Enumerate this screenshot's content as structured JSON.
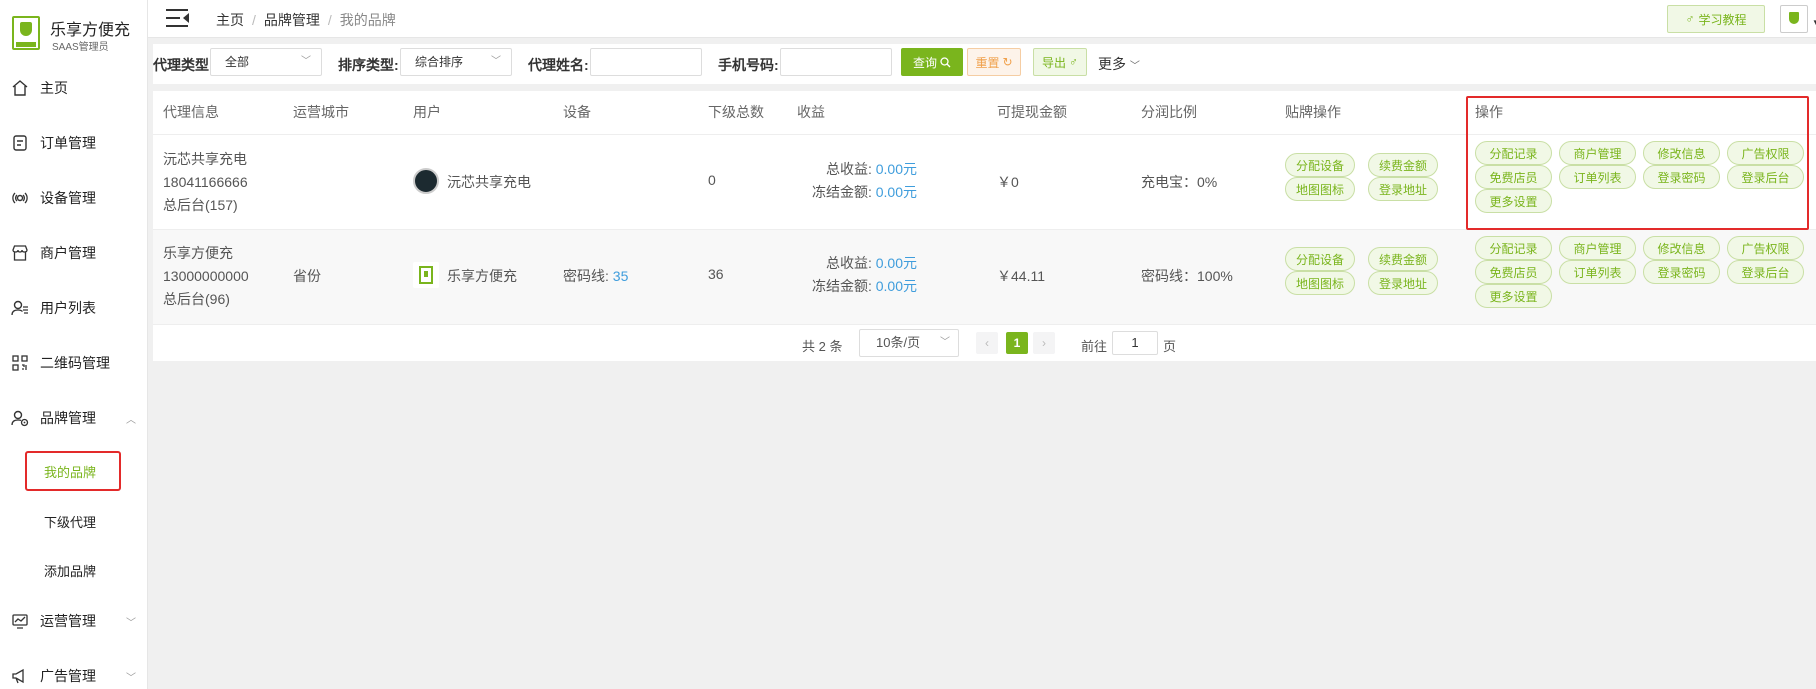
{
  "app": {
    "title": "乐享方便充",
    "subtitle": "SAAS管理员",
    "accent": "#7ab51d"
  },
  "sidebar": {
    "items": [
      {
        "label": "主页",
        "icon": "home-icon"
      },
      {
        "label": "订单管理",
        "icon": "order-icon"
      },
      {
        "label": "设备管理",
        "icon": "device-icon"
      },
      {
        "label": "商户管理",
        "icon": "shop-icon"
      },
      {
        "label": "用户列表",
        "icon": "users-icon"
      },
      {
        "label": "二维码管理",
        "icon": "qrcode-icon"
      },
      {
        "label": "品牌管理",
        "icon": "brand-icon"
      },
      {
        "label": "运营管理",
        "icon": "operation-icon"
      },
      {
        "label": "广告管理",
        "icon": "ad-icon"
      }
    ],
    "brand_sub": [
      {
        "label": "我的品牌"
      },
      {
        "label": "下级代理"
      },
      {
        "label": "添加品牌"
      }
    ]
  },
  "header": {
    "breadcrumb": [
      "主页",
      "品牌管理",
      "我的品牌"
    ],
    "learn_button": "学习教程"
  },
  "filters": {
    "agent_type_label": "代理类型:",
    "agent_type_value": "全部",
    "sort_type_label": "排序类型:",
    "sort_type_value": "综合排序",
    "agent_name_label": "代理姓名:",
    "agent_name_value": "",
    "phone_label": "手机号码:",
    "phone_value": "",
    "query_button": "查询",
    "reset_button": "重置",
    "export_button": "导出",
    "more_label": "更多"
  },
  "table": {
    "columns": [
      "代理信息",
      "运营城市",
      "用户",
      "设备",
      "下级总数",
      "收益",
      "可提现金额",
      "分润比例",
      "贴牌操作",
      "操作"
    ],
    "rows": [
      {
        "name": "沅芯共享充电",
        "phone": "18041166666",
        "backend": "总后台(157)",
        "city": "",
        "user": "沅芯共享充电",
        "device_label": "",
        "device_value": "",
        "sub_total": "0",
        "total_income_label": "总收益:",
        "total_income": "0.00元",
        "frozen_label": "冻结金额:",
        "frozen": "0.00元",
        "withdrawable": "￥0",
        "share": "充电宝：0%"
      },
      {
        "name": "乐享方便充",
        "phone": "13000000000",
        "backend": "总后台(96)",
        "city": "省份",
        "user": "乐享方便充",
        "device_label": "密码线:",
        "device_value": "35",
        "sub_total": "36",
        "total_income_label": "总收益:",
        "total_income": "0.00元",
        "frozen_label": "冻结金额:",
        "frozen": "0.00元",
        "withdrawable": "￥44.11",
        "share": "密码线：100%"
      }
    ],
    "brand_actions": [
      "分配设备",
      "续费金额",
      "地图图标",
      "登录地址"
    ],
    "actions": [
      "分配记录",
      "商户管理",
      "修改信息",
      "广告权限",
      "免费店员",
      "订单列表",
      "登录密码",
      "登录后台",
      "更多设置"
    ]
  },
  "pagination": {
    "total": "共 2 条",
    "page_size": "10条/页",
    "current": "1",
    "goto_label": "前往",
    "goto_value": "1",
    "page_suffix": "页"
  }
}
